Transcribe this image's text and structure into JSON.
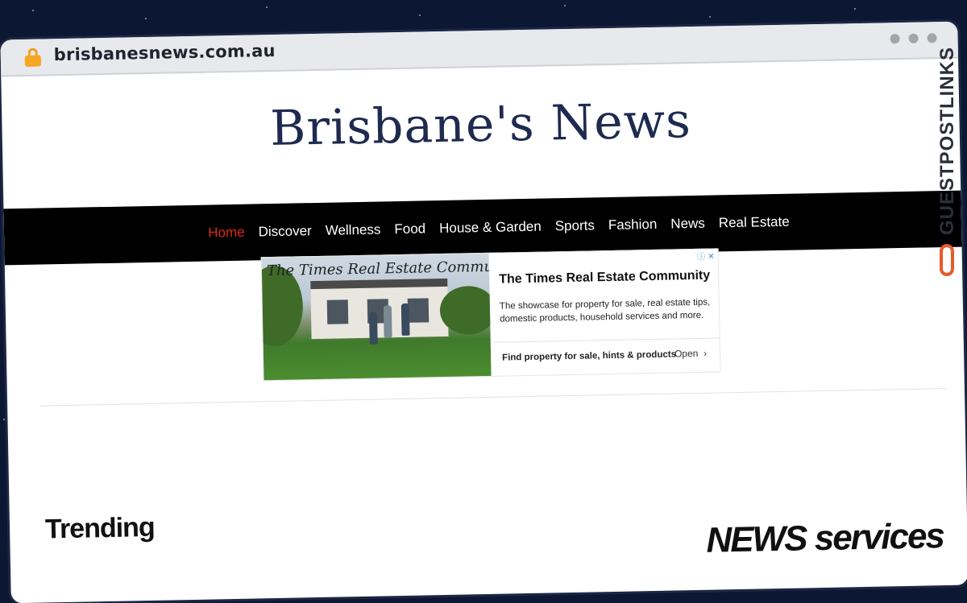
{
  "browser": {
    "url": "brisbanesnews.com.au",
    "lock_icon": "lock-icon"
  },
  "site": {
    "title": "Brisbane's News"
  },
  "nav": {
    "items": [
      "Home",
      "Discover",
      "Wellness",
      "Food",
      "House & Garden",
      "Sports",
      "Fashion",
      "News",
      "Real Estate"
    ],
    "active": "Home"
  },
  "ad": {
    "script_text": "The Times Real Estate Community",
    "title": "The Times Real Estate Community",
    "description": "The showcase for property for sale, real estate tips, domestic products, household services and more.",
    "cta": "Find property for sale, hints & products",
    "open_label": "Open",
    "adchoices": "ⓘ ✕"
  },
  "main": {
    "trending": "Trending",
    "logo_text": "NEWS services"
  },
  "watermark": {
    "text": "GUESTPOSTLINKS"
  },
  "colors": {
    "nav_bg": "#000000",
    "nav_active": "#e0281b",
    "title": "#1e2a4f",
    "background": "#0b1733"
  }
}
